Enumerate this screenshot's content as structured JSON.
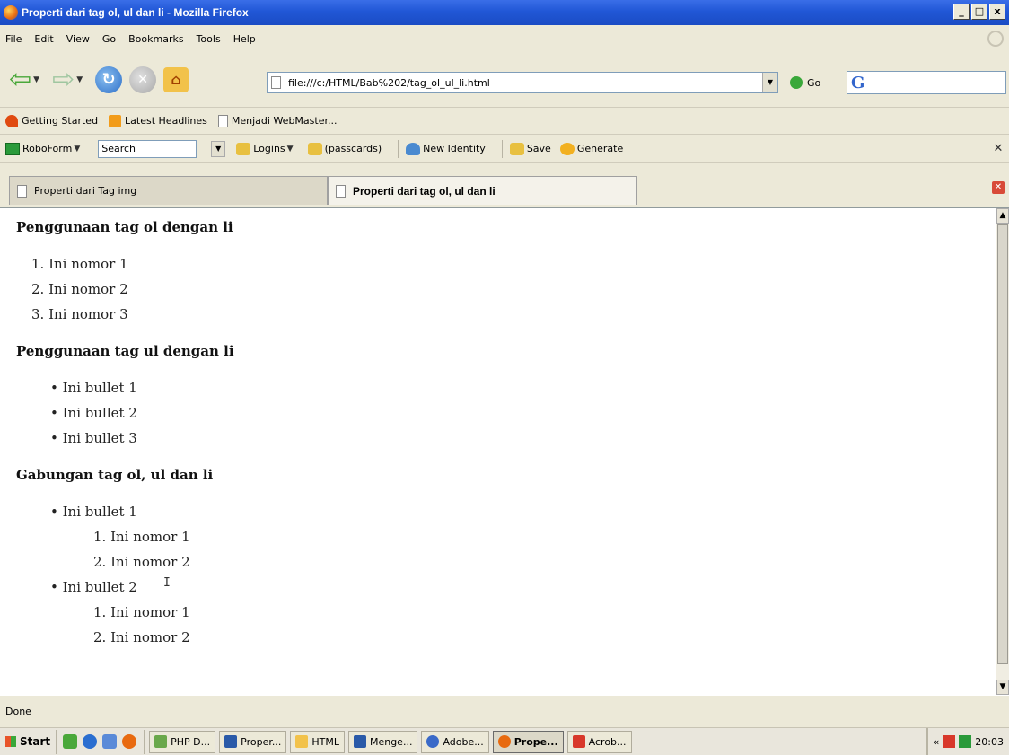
{
  "window": {
    "title": "Properti dari tag ol, ul dan li - Mozilla Firefox",
    "controls": [
      "_",
      "□",
      "x"
    ]
  },
  "menu": [
    "File",
    "Edit",
    "View",
    "Go",
    "Bookmarks",
    "Tools",
    "Help"
  ],
  "navigation": {
    "url": "file:///c:/HTML/Bab%202/tag_ol_ul_li.html",
    "go_label": "Go",
    "search_engine_icon": "G"
  },
  "bookmarks": [
    {
      "label": "Getting Started",
      "icon": "firefox-icon"
    },
    {
      "label": "Latest Headlines",
      "icon": "rss-icon"
    },
    {
      "label": "Menjadi WebMaster...",
      "icon": "page-icon"
    }
  ],
  "roboform": {
    "brand": "RoboForm",
    "search_value": "Search",
    "logins": "Logins",
    "passcards": "(passcards)",
    "new_identity": "New Identity",
    "save": "Save",
    "generate": "Generate"
  },
  "tabs": [
    {
      "label": "Properti dari Tag img",
      "active": false
    },
    {
      "label": "Properti dari tag ol, ul dan li",
      "active": true
    }
  ],
  "content": {
    "section1": {
      "heading": "Penggunaan tag ol dengan li",
      "items": [
        "1.  Ini nomor 1",
        "2.  Ini nomor 2",
        "3.  Ini nomor 3"
      ]
    },
    "section2": {
      "heading": "Penggunaan tag ul dengan li",
      "items": [
        "•  Ini bullet 1",
        "•  Ini bullet 2",
        "•  Ini bullet 3"
      ]
    },
    "section3": {
      "heading": "Gabungan tag ol, ul dan li",
      "b1": "•  Ini bullet 1",
      "b1_items": [
        "1.  Ini nomor 1",
        "2.  Ini nomor 2"
      ],
      "b2": "•  Ini bullet 2",
      "b2_items": [
        "1.  Ini nomor 1",
        "2.  Ini nomor 2"
      ]
    }
  },
  "status": "Done",
  "taskbar": {
    "start": "Start",
    "tasks": [
      {
        "label": "PHP D...",
        "active": false
      },
      {
        "label": "Proper...",
        "active": false
      },
      {
        "label": "HTML",
        "active": false
      },
      {
        "label": "Menge...",
        "active": false
      },
      {
        "label": "Adobe...",
        "active": false
      },
      {
        "label": "Prope...",
        "active": true
      },
      {
        "label": "Acrob...",
        "active": false
      }
    ],
    "tray_chevron": "«",
    "clock": "20:03"
  }
}
